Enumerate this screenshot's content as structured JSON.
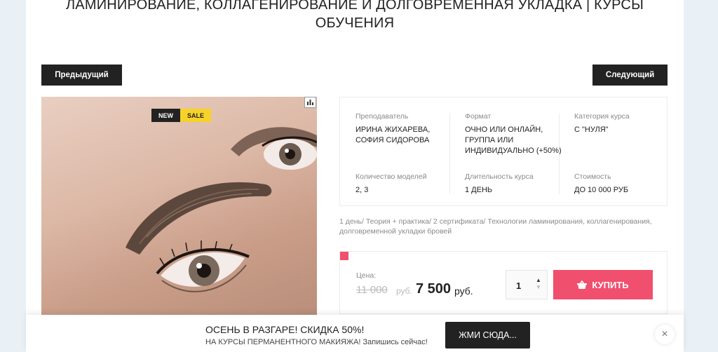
{
  "header": {
    "title_line1": "ЛАМИНИРОВАНИЕ, КОЛЛАГЕНИРОВАНИЕ И ДОЛГОВРЕМЕННАЯ УКЛАДКА | КУРСЫ",
    "title_line2": "ОБУЧЕНИЯ"
  },
  "nav": {
    "prev_label": "Предыдущий",
    "next_label": "Следующий"
  },
  "product": {
    "badges": {
      "new": "NEW",
      "sale": "SALE"
    },
    "compare_icon": "bar-chart-icon"
  },
  "info": {
    "teacher_label": "Преподаватель",
    "teacher_value": "ИРИНА ЖИХАРЕВА, СОФИЯ СИДОРОВА",
    "format_label": "Формат",
    "format_value": "ОЧНО ИЛИ ОНЛАЙН, ГРУППА ИЛИ ИНДИВИДУАЛЬНО (+50%)",
    "category_label": "Категория курса",
    "category_value": "С \"НУЛЯ\"",
    "models_label": "Количество моделей",
    "models_value": "2, 3",
    "duration_label": "Длительность курса",
    "duration_value": "1 ДЕНЬ",
    "cost_label": "Стоимость",
    "cost_value": "ДО 10 000 РУБ"
  },
  "description": "1 день/ Теория + практика/ 2 сертификата/ Технологии ламинирования, коллагенирования, долговременной укладки бровей",
  "purchase": {
    "price_label": "Цена:",
    "old_price": "11 000",
    "old_currency": "руб.",
    "new_price": "7 500",
    "new_currency": "руб.",
    "quantity": "1",
    "buy_label": "Купить",
    "accent_color": "#f0506e"
  },
  "promo": {
    "title": "ОСЕНЬ В РАЗГАРЕ! СКИДКА 50%!",
    "subtitle": "НА КУРСЫ ПЕРМАНЕНТНОГО МАКИЯЖА! Запишись сейчас!",
    "button_label": "ЖМИ СЮДА...",
    "close_label": "×"
  }
}
